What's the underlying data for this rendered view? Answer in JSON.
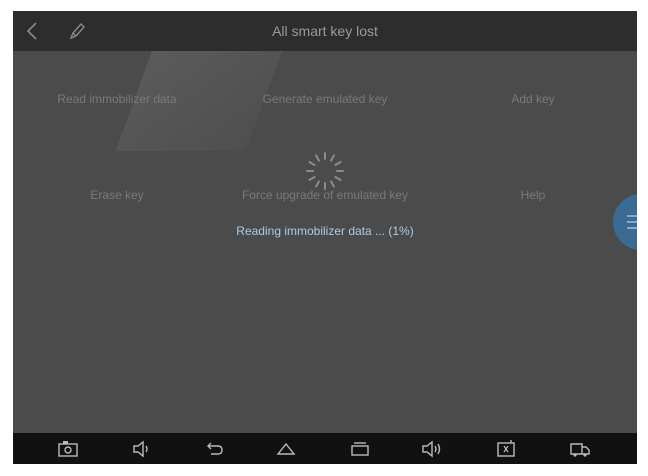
{
  "header": {
    "title": "All smart key lost"
  },
  "menu": {
    "items": [
      {
        "label": "Read immobilizer data"
      },
      {
        "label": "Generate emulated key"
      },
      {
        "label": "Add key"
      },
      {
        "label": "Erase key"
      },
      {
        "label": "Force upgrade of emulated key"
      },
      {
        "label": "Help"
      }
    ]
  },
  "status": {
    "progress_text": "Reading immobilizer data ... (1%)",
    "progress_value": 1
  },
  "colors": {
    "background": "#4b4b4b",
    "header": "#2d2d2d",
    "navbar": "#111111",
    "accent": "#3b6a93",
    "progress_text": "#a8cce8"
  },
  "icons": [
    "back-icon",
    "edit-icon",
    "spinner-icon",
    "menu-icon",
    "screenshot-icon",
    "volume-down-icon",
    "back-nav-icon",
    "home-icon",
    "recents-icon",
    "volume-up-icon",
    "vci-icon",
    "truck-icon"
  ]
}
